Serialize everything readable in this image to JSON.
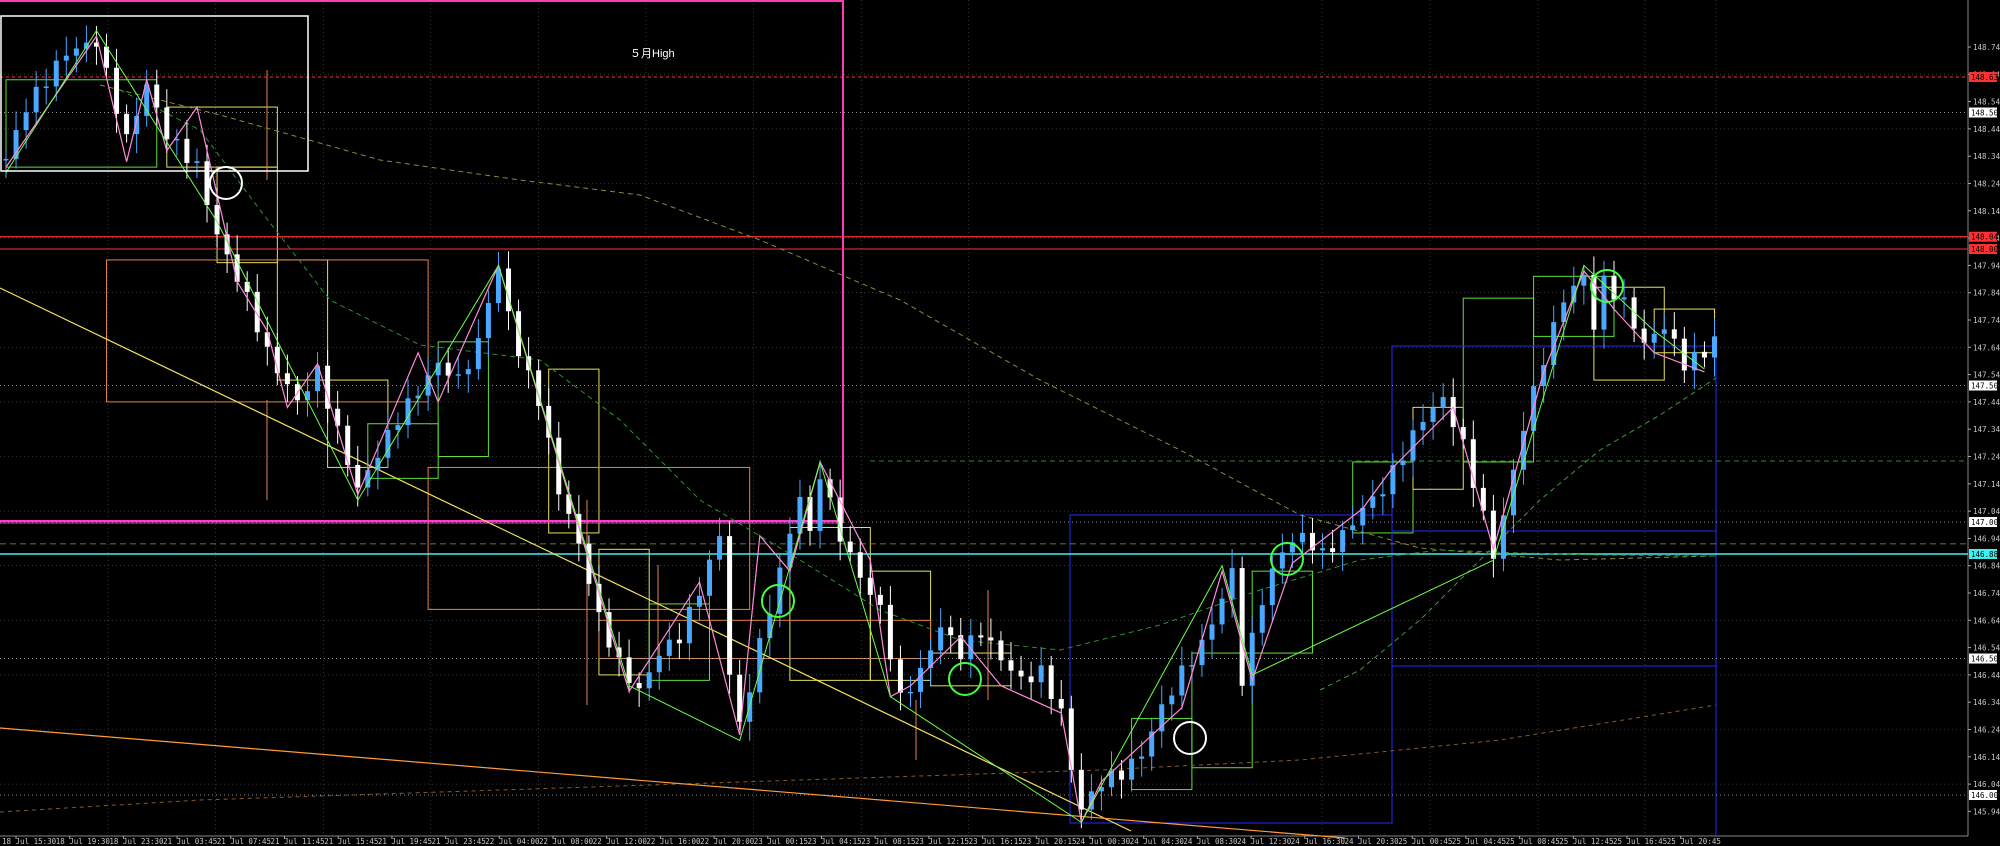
{
  "chart_data": {
    "type": "candlestick",
    "title": "",
    "xlabel": "",
    "ylabel": "",
    "ylim": [
      145.88,
      148.9
    ],
    "grid": true,
    "colors": {
      "background": "#000000",
      "grid": "#5a5a5a",
      "candle_up": "#4aa8ff",
      "candle_down": "#ffffff",
      "zigzag_pink": "#ff8ad8",
      "zigzag_green": "#6cff4a",
      "box_yellow": "#e8e05a",
      "box_green": "#5ee03a",
      "box_orange": "#e2844a",
      "box_blue": "#2828ff",
      "trend_yellow": "#f0e060",
      "trend_orange": "#ff9b3a",
      "level_magenta": "#ff3cd2",
      "level_cyan": "#40f0f0",
      "level_red": "#ff3030",
      "vline_magenta": "#ff3cb8",
      "marker_white": "#ffffff",
      "marker_green": "#40ff40"
    },
    "y_ticks": [
      "148.740",
      "148.640",
      "148.540",
      "148.440",
      "148.340",
      "148.240",
      "148.140",
      "148.040",
      "147.940",
      "147.840",
      "147.740",
      "147.640",
      "147.540",
      "147.440",
      "147.340",
      "147.240",
      "147.140",
      "147.040",
      "146.940",
      "146.840",
      "146.740",
      "146.640",
      "146.540",
      "146.440",
      "146.340",
      "146.240",
      "146.140",
      "146.040",
      "145.940"
    ],
    "x_ticks": [
      "18 Jul 15:30",
      "18 Jul 19:30",
      "18 Jul 23:30",
      "21 Jul 03:45",
      "21 Jul 07:45",
      "21 Jul 11:45",
      "21 Jul 15:45",
      "21 Jul 19:45",
      "21 Jul 23:45",
      "22 Jul 04:00",
      "22 Jul 08:00",
      "22 Jul 12:00",
      "22 Jul 16:00",
      "22 Jul 20:00",
      "23 Jul 00:15",
      "23 Jul 04:15",
      "23 Jul 08:15",
      "23 Jul 12:15",
      "23 Jul 16:15",
      "23 Jul 20:15",
      "24 Jul 00:30",
      "24 Jul 04:30",
      "24 Jul 08:30",
      "24 Jul 12:30",
      "24 Jul 16:30",
      "24 Jul 20:30",
      "25 Jul 00:45",
      "25 Jul 04:45",
      "25 Jul 08:45",
      "25 Jul 12:45",
      "25 Jul 16:45",
      "25 Jul 20:45"
    ],
    "price_labels": [
      {
        "text": "148.630",
        "color": "#ff3030"
      },
      {
        "text": "148.500",
        "color": "#ffffff"
      },
      {
        "text": "148.045",
        "color": "#ff3030"
      },
      {
        "text": "148.000",
        "color": "#ff3030"
      },
      {
        "text": "147.500",
        "color": "#ffffff"
      },
      {
        "text": "147.000",
        "color": "#ffffff"
      },
      {
        "text": "146.883",
        "color": "#40f0f0"
      },
      {
        "text": "146.500",
        "color": "#ffffff"
      },
      {
        "text": "146.000",
        "color": "#ffffff"
      }
    ],
    "annotations": [
      {
        "text": "５月High"
      }
    ],
    "anchors": [
      [
        0,
        148.33
      ],
      [
        2,
        148.52
      ],
      [
        6,
        148.72
      ],
      [
        9,
        148.76
      ],
      [
        12,
        148.4
      ],
      [
        14,
        148.6
      ],
      [
        16,
        148.42
      ],
      [
        19,
        148.3
      ],
      [
        21,
        148.05
      ],
      [
        24,
        147.82
      ],
      [
        26,
        147.62
      ],
      [
        29,
        147.44
      ],
      [
        31,
        147.55
      ],
      [
        33,
        147.33
      ],
      [
        35,
        147.12
      ],
      [
        37,
        147.25
      ],
      [
        39,
        147.38
      ],
      [
        41,
        147.48
      ],
      [
        43,
        147.58
      ],
      [
        45,
        147.52
      ],
      [
        47,
        147.65
      ],
      [
        48,
        147.82
      ],
      [
        49,
        147.92
      ],
      [
        51,
        147.62
      ],
      [
        53,
        147.45
      ],
      [
        55,
        147.12
      ],
      [
        57,
        146.92
      ],
      [
        59,
        146.65
      ],
      [
        61,
        146.48
      ],
      [
        63,
        146.38
      ],
      [
        65,
        146.52
      ],
      [
        67,
        146.58
      ],
      [
        69,
        146.75
      ],
      [
        71,
        146.95
      ],
      [
        72,
        146.45
      ],
      [
        73,
        146.25
      ],
      [
        75,
        146.55
      ],
      [
        77,
        146.82
      ],
      [
        79,
        147.1
      ],
      [
        80,
        146.95
      ],
      [
        81,
        147.18
      ],
      [
        83,
        146.95
      ],
      [
        85,
        146.8
      ],
      [
        87,
        146.68
      ],
      [
        88,
        146.52
      ],
      [
        89,
        146.35
      ],
      [
        91,
        146.45
      ],
      [
        93,
        146.62
      ],
      [
        95,
        146.52
      ],
      [
        97,
        146.6
      ],
      [
        99,
        146.5
      ],
      [
        101,
        146.42
      ],
      [
        103,
        146.45
      ],
      [
        105,
        146.3
      ],
      [
        106,
        146.1
      ],
      [
        107,
        145.95
      ],
      [
        109,
        146.05
      ],
      [
        111,
        146.08
      ],
      [
        113,
        146.15
      ],
      [
        115,
        146.32
      ],
      [
        117,
        146.45
      ],
      [
        119,
        146.55
      ],
      [
        121,
        146.72
      ],
      [
        122,
        146.82
      ],
      [
        123,
        146.42
      ],
      [
        125,
        146.72
      ],
      [
        127,
        146.9
      ],
      [
        129,
        146.95
      ],
      [
        131,
        146.88
      ],
      [
        133,
        146.95
      ],
      [
        135,
        147.05
      ],
      [
        137,
        147.12
      ],
      [
        139,
        147.25
      ],
      [
        141,
        147.38
      ],
      [
        143,
        147.45
      ],
      [
        145,
        147.28
      ],
      [
        147,
        147.02
      ],
      [
        148,
        146.88
      ],
      [
        149,
        147.02
      ],
      [
        151,
        147.35
      ],
      [
        153,
        147.6
      ],
      [
        155,
        147.82
      ],
      [
        157,
        147.9
      ],
      [
        158,
        147.72
      ],
      [
        159,
        147.88
      ],
      [
        161,
        147.8
      ],
      [
        163,
        147.65
      ],
      [
        165,
        147.72
      ],
      [
        167,
        147.58
      ],
      [
        169,
        147.62
      ],
      [
        170,
        147.68
      ]
    ]
  }
}
